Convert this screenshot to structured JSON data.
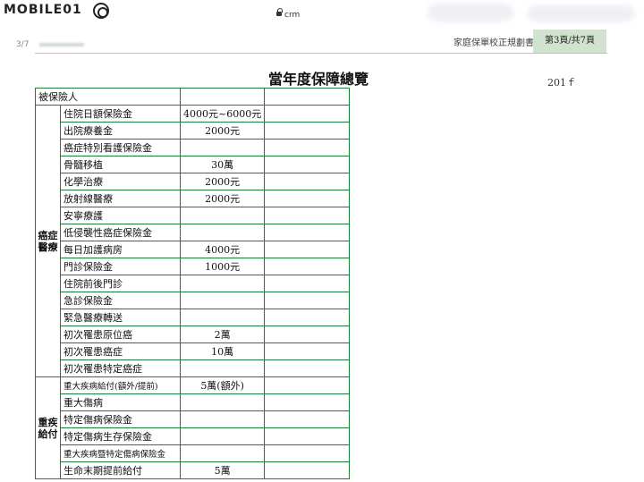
{
  "browser": {
    "brand": "MOBILE01",
    "url": "crm"
  },
  "doc_header": {
    "page_fraction": "3/7",
    "doc_title": "家庭保單校正規劃書",
    "page_number": "第3頁/共7頁"
  },
  "title": "當年度保障總覽",
  "year": "201ｆ",
  "insured_label": "被保險人",
  "groups": [
    {
      "name": "癌症\n醫療",
      "rows": [
        {
          "label": "住院日額保險金",
          "value": "4000元~6000元"
        },
        {
          "label": "出院療養金",
          "value": "2000元"
        },
        {
          "label": "癌症特別看護保險金",
          "value": ""
        },
        {
          "label": "骨髓移植",
          "value": "30萬"
        },
        {
          "label": "化學治療",
          "value": "2000元"
        },
        {
          "label": "放射線醫療",
          "value": "2000元"
        },
        {
          "label": "安寧療護",
          "value": ""
        },
        {
          "label": "低侵襲性癌症保險金",
          "value": ""
        },
        {
          "label": "每日加護病房",
          "value": "4000元"
        },
        {
          "label": "門診保險金",
          "value": "1000元"
        },
        {
          "label": "住院前後門診",
          "value": ""
        },
        {
          "label": "急診保險金",
          "value": ""
        },
        {
          "label": "緊急醫療轉送",
          "value": ""
        },
        {
          "label": "初次罹患原位癌",
          "value": "2萬"
        },
        {
          "label": "初次罹患癌症",
          "value": "10萬"
        },
        {
          "label": "初次罹患特定癌症",
          "value": ""
        }
      ]
    },
    {
      "name": "重疾\n給付",
      "rows": [
        {
          "label": "重大疾病給付(額外/提前)",
          "value": "5萬(額外)"
        },
        {
          "label": "重大傷病",
          "value": ""
        },
        {
          "label": "特定傷病保險金",
          "value": ""
        },
        {
          "label": "特定傷病生存保險金",
          "value": ""
        },
        {
          "label": "重大疾病暨特定傷病保險金",
          "value": ""
        },
        {
          "label": "生命末期提前給付",
          "value": "5萬"
        }
      ]
    }
  ]
}
